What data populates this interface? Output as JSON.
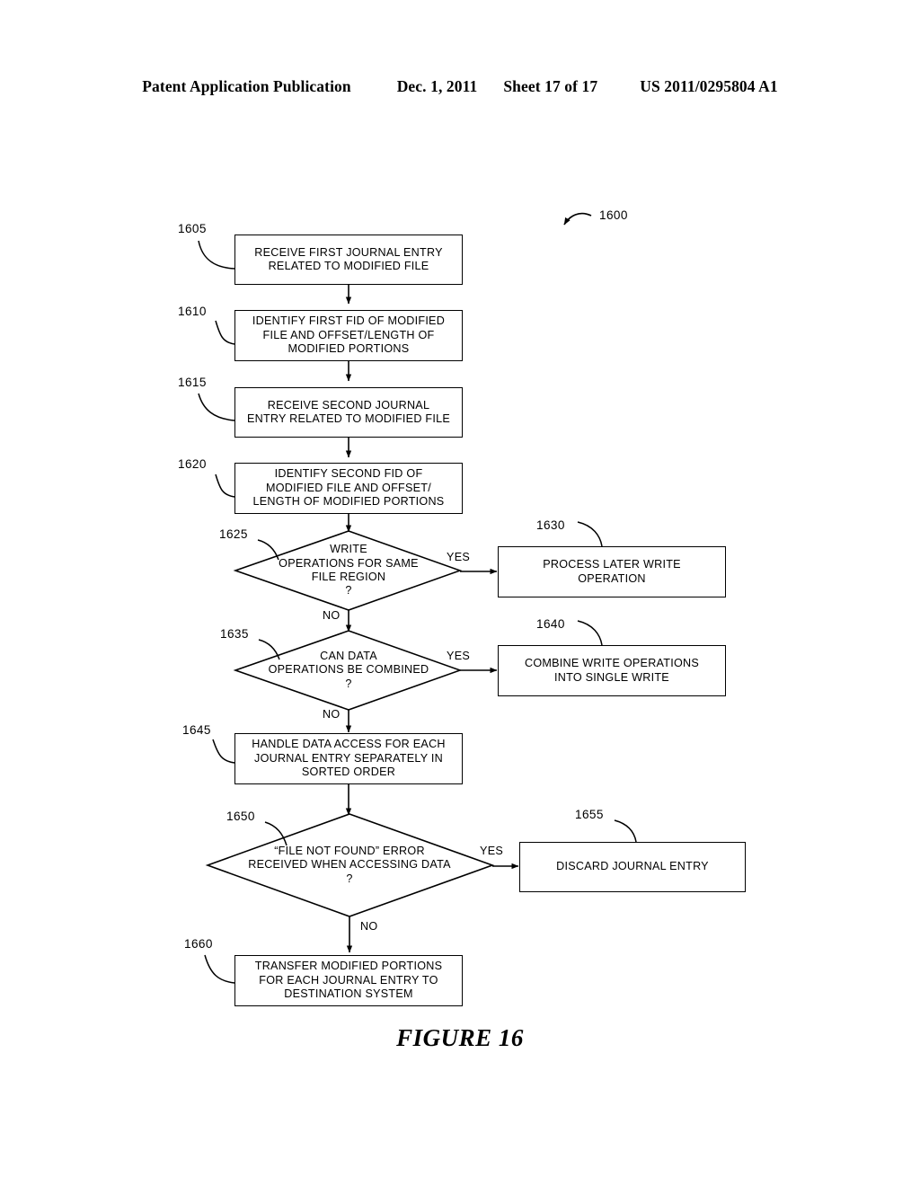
{
  "header": {
    "publication": "Patent Application Publication",
    "date": "Dec. 1, 2011",
    "sheet": "Sheet 17 of 17",
    "pub_number": "US 2011/0295804 A1"
  },
  "figure": {
    "caption": "FIGURE 16",
    "diagram_ref": "1600"
  },
  "nodes": [
    {
      "ref": "1605",
      "type": "process",
      "text": "RECEIVE FIRST JOURNAL ENTRY\nRELATED TO MODIFIED FILE"
    },
    {
      "ref": "1610",
      "type": "process",
      "text": "IDENTIFY FIRST FID OF MODIFIED\nFILE AND OFFSET/LENGTH OF\nMODIFIED PORTIONS"
    },
    {
      "ref": "1615",
      "type": "process",
      "text": "RECEIVE SECOND JOURNAL\nENTRY RELATED TO MODIFIED FILE"
    },
    {
      "ref": "1620",
      "type": "process",
      "text": "IDENTIFY SECOND FID OF\nMODIFIED FILE AND OFFSET/\nLENGTH OF MODIFIED PORTIONS"
    },
    {
      "ref": "1625",
      "type": "decision",
      "text": "WRITE\nOPERATIONS FOR SAME\nFILE REGION\n?"
    },
    {
      "ref": "1630",
      "type": "process",
      "text": "PROCESS LATER WRITE\nOPERATION"
    },
    {
      "ref": "1635",
      "type": "decision",
      "text": "CAN DATA\nOPERATIONS BE COMBINED\n?"
    },
    {
      "ref": "1640",
      "type": "process",
      "text": "COMBINE WRITE OPERATIONS\nINTO SINGLE WRITE"
    },
    {
      "ref": "1645",
      "type": "process",
      "text": "HANDLE DATA ACCESS FOR EACH\nJOURNAL ENTRY SEPARATELY IN\nSORTED ORDER"
    },
    {
      "ref": "1650",
      "type": "decision",
      "text": "“FILE NOT FOUND” ERROR\nRECEIVED WHEN ACCESSING DATA\n?"
    },
    {
      "ref": "1655",
      "type": "process",
      "text": "DISCARD JOURNAL ENTRY"
    },
    {
      "ref": "1660",
      "type": "process",
      "text": "TRANSFER MODIFIED PORTIONS\nFOR EACH JOURNAL ENTRY TO\nDESTINATION SYSTEM"
    }
  ],
  "edge_labels": {
    "yes_1625": "YES",
    "no_1625": "NO",
    "yes_1635": "YES",
    "no_1635": "NO",
    "yes_1650": "YES",
    "no_1650": "NO"
  }
}
